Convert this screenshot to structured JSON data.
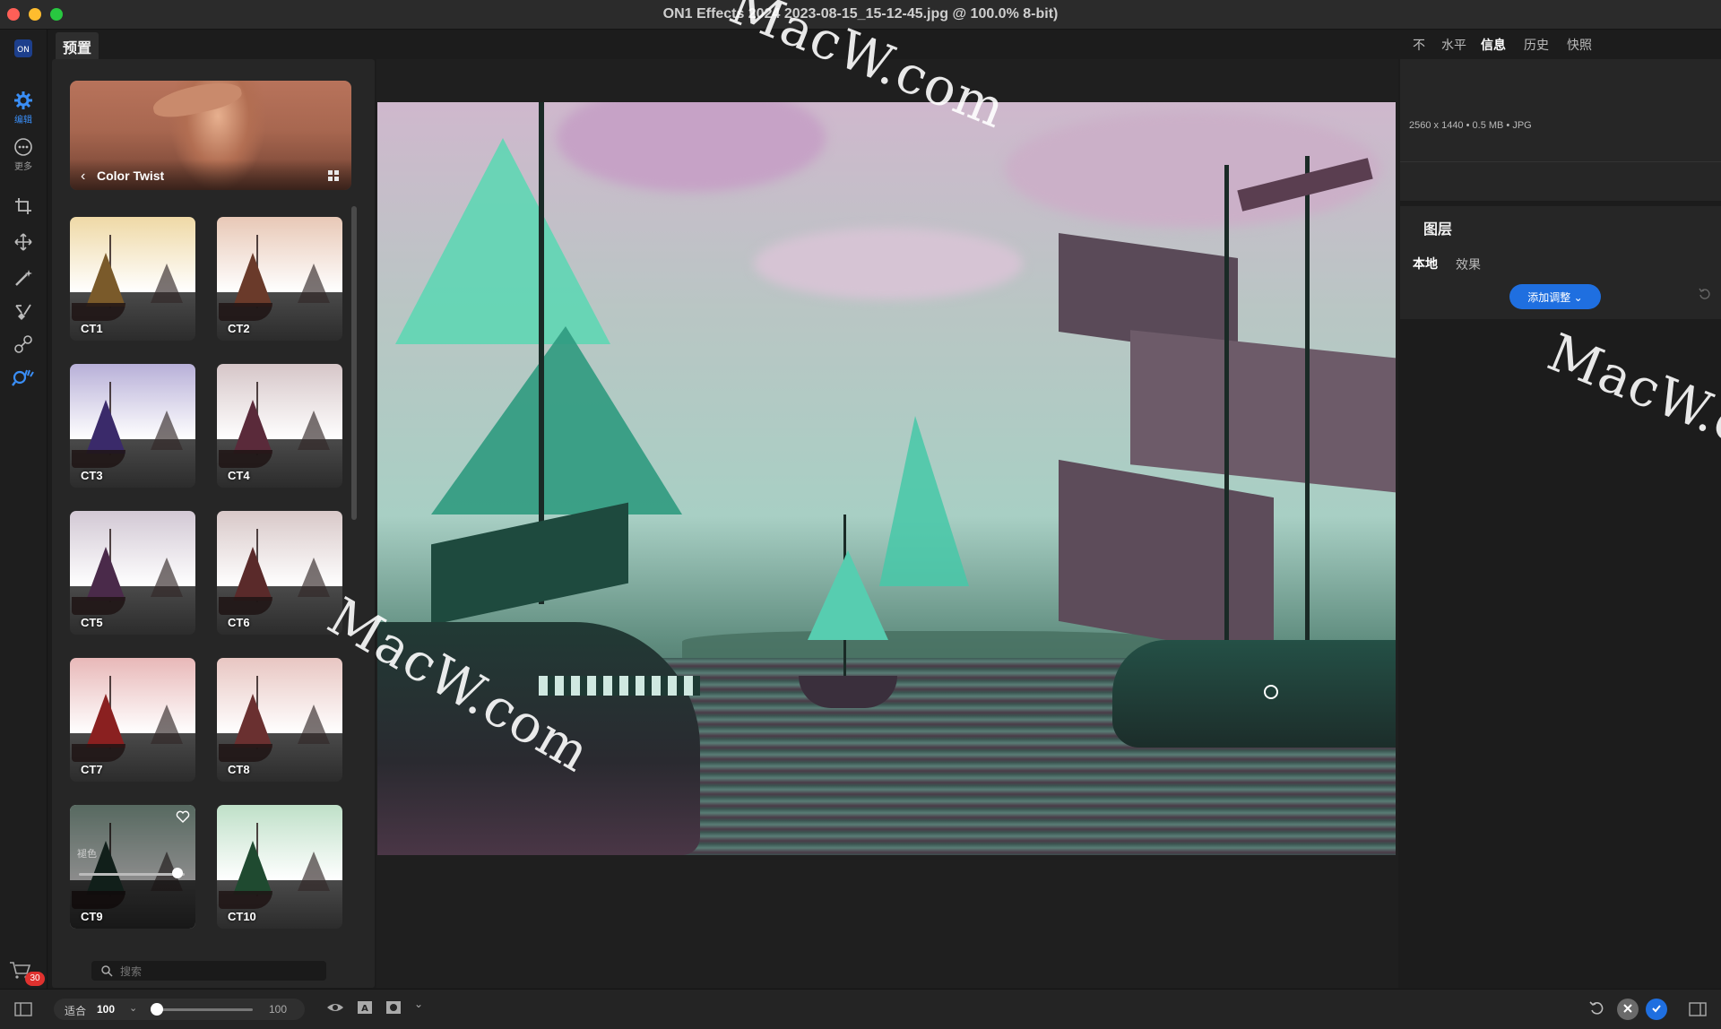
{
  "window": {
    "title": "ON1 Effects 2024 2023-08-15_15-12-45.jpg @ 100.0% 8-bit)",
    "traffic_lights": [
      "#fe5f57",
      "#febc2e",
      "#28c840"
    ]
  },
  "toolstrip": {
    "items": [
      {
        "icon": "edit-gear-icon",
        "label": "编辑",
        "active": true
      },
      {
        "icon": "more-icon",
        "label": "更多",
        "active": false
      },
      {
        "icon": "crop-icon",
        "label": ""
      },
      {
        "icon": "move-icon",
        "label": ""
      },
      {
        "icon": "magic-wand-icon",
        "label": ""
      },
      {
        "icon": "brush-icon",
        "label": ""
      },
      {
        "icon": "clone-icon",
        "label": ""
      },
      {
        "icon": "zoom-hand-icon",
        "label": ""
      }
    ],
    "accent": "#3a8ef6"
  },
  "presets": {
    "tab_label": "预置",
    "category_title": "Color Twist",
    "items": [
      {
        "label": "CT1",
        "sky": "#efd9a6",
        "tint": "#7a5a2a"
      },
      {
        "label": "CT2",
        "sky": "#e8c8b6",
        "tint": "#6a3a2a"
      },
      {
        "label": "CT3",
        "sky": "#b8b0d8",
        "tint": "#3a2a6a"
      },
      {
        "label": "CT4",
        "sky": "#d6c6c8",
        "tint": "#5a2a3a"
      },
      {
        "label": "CT5",
        "sky": "#d2c8d4",
        "tint": "#4a2a4a"
      },
      {
        "label": "CT6",
        "sky": "#d8c8c8",
        "tint": "#5a2a2a"
      },
      {
        "label": "CT7",
        "sky": "#e8b8b8",
        "tint": "#8a2020"
      },
      {
        "label": "CT8",
        "sky": "#e8c6c2",
        "tint": "#6a3030"
      },
      {
        "label": "CT9",
        "sky": "#9fc0b0",
        "tint": "#1f3a30",
        "selected": true,
        "opacity_label": "褪色",
        "opacity": 0.93
      },
      {
        "label": "CT10",
        "sky": "#bfe0c8",
        "tint": "#1f4a30"
      }
    ],
    "search_placeholder": "搜索",
    "cart_badge": "30"
  },
  "right_panel": {
    "tabs": [
      {
        "label": "不",
        "active": false
      },
      {
        "label": "水平",
        "active": false
      },
      {
        "label": "信息",
        "active": true
      },
      {
        "label": "历史",
        "active": false
      },
      {
        "label": "快照",
        "active": false
      }
    ],
    "info": "2560 x 1440  •  0.5 MB  •  JPG",
    "layers_title": "图层",
    "layer_tabs": [
      "本地",
      "效果"
    ],
    "add_adjustment": "添加调整 ⌄"
  },
  "bottom_bar": {
    "fit_label": "适合",
    "zoom_value": "100",
    "zoom_max": "100",
    "zoom_fraction": 0.03
  },
  "watermarks": [
    "MacW.com",
    "MacW.com",
    "MacW.c"
  ]
}
